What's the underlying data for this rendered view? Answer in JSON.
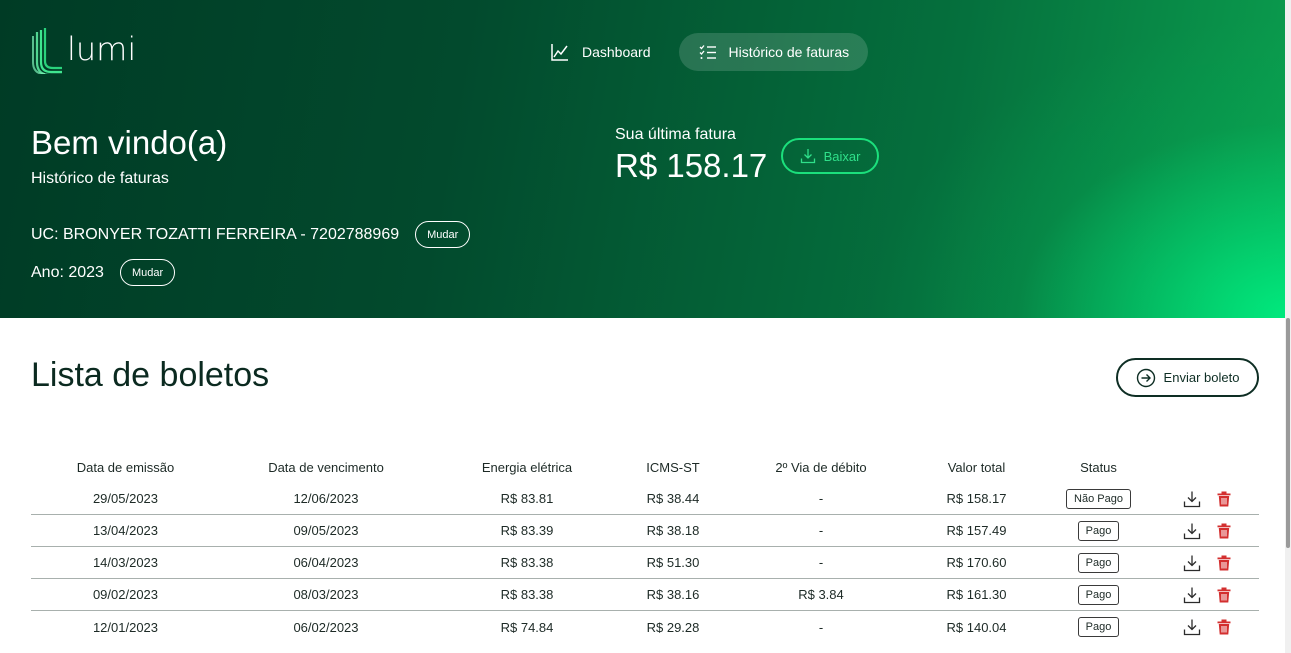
{
  "brand": {
    "name": "lumi"
  },
  "nav": {
    "items": [
      {
        "label": "Dashboard",
        "icon": "chart-line-icon",
        "active": false
      },
      {
        "label": "Histórico de faturas",
        "icon": "list-icon",
        "active": true
      }
    ]
  },
  "hero": {
    "welcome": "Bem vindo(a)",
    "subtitle": "Histórico de faturas",
    "uc_label": "UC: BRONYER TOZATTI FERREIRA - 7202788969",
    "uc_change": "Mudar",
    "ano_label": "Ano: 2023",
    "ano_change": "Mudar",
    "last_invoice_label": "Sua última fatura",
    "last_invoice_value": "R$ 158.17",
    "download_label": "Baixar"
  },
  "list": {
    "title": "Lista de boletos",
    "send_label": "Enviar boleto",
    "columns": [
      "Data de emissão",
      "Data de vencimento",
      "Energia elétrica",
      "ICMS-ST",
      "2º Via de débito",
      "Valor total",
      "Status"
    ],
    "rows": [
      [
        "29/05/2023",
        "12/06/2023",
        "R$ 83.81",
        "R$ 38.44",
        "-",
        "R$ 158.17",
        "Não Pago"
      ],
      [
        "13/04/2023",
        "09/05/2023",
        "R$ 83.39",
        "R$ 38.18",
        "-",
        "R$ 157.49",
        "Pago"
      ],
      [
        "14/03/2023",
        "06/04/2023",
        "R$ 83.38",
        "R$ 51.30",
        "-",
        "R$ 170.60",
        "Pago"
      ],
      [
        "09/02/2023",
        "08/03/2023",
        "R$ 83.38",
        "R$ 38.16",
        "R$ 3.84",
        "R$ 161.30",
        "Pago"
      ],
      [
        "12/01/2023",
        "06/02/2023",
        "R$ 74.84",
        "R$ 29.28",
        "-",
        "R$ 140.04",
        "Pago"
      ]
    ]
  },
  "colors": {
    "hero_dark": "#003b25",
    "hero_accent": "#00ea7e",
    "button_green": "#1be07c",
    "delete_red": "#d32f2f"
  }
}
